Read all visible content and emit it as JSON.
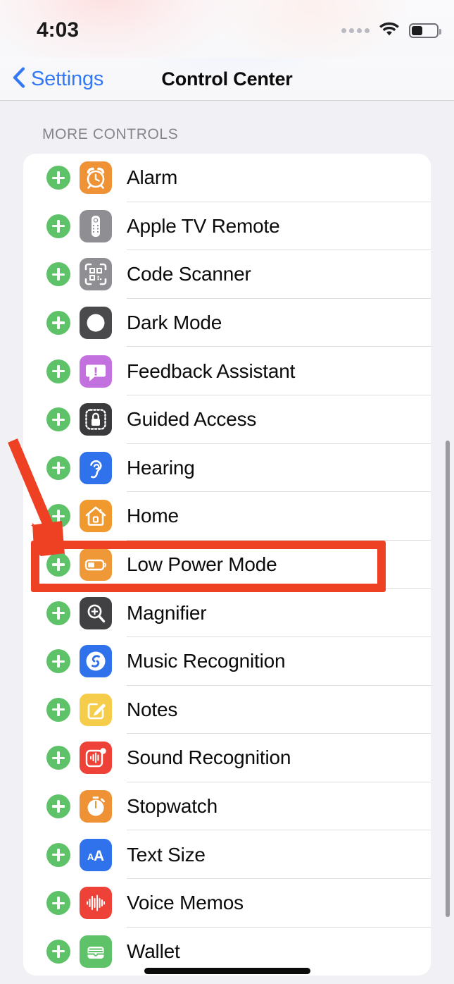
{
  "status_bar": {
    "time": "4:03",
    "cellular_icon": "cellular-dots-icon",
    "cellular_dots": 4,
    "wifi_icon": "wifi-icon",
    "battery_icon": "battery-icon",
    "battery_level_percent": 38
  },
  "nav": {
    "back_icon": "chevron-left-icon",
    "back_label": "Settings",
    "title": "Control Center"
  },
  "section": {
    "header": "MORE CONTROLS"
  },
  "colors": {
    "accent_blue": "#3478f6",
    "add_green": "#5ec269",
    "annotation_red": "#ee4023",
    "page_background": "#f1f1f5",
    "card_background": "#ffffff"
  },
  "annotation": {
    "highlight_target": "Hearing",
    "box_color": "#ee4023",
    "arrow_color": "#ee4023",
    "arrow_icon": "arrow-pointing-down-right-icon"
  },
  "rows": [
    {
      "label": "Alarm",
      "add_icon": "add-plus-icon",
      "icon": "alarm-clock-icon",
      "icon_bg": "#ef9235",
      "highlighted": false
    },
    {
      "label": "Apple TV Remote",
      "add_icon": "add-plus-icon",
      "icon": "tv-remote-icon",
      "icon_bg": "#8e8e93",
      "highlighted": false
    },
    {
      "label": "Code Scanner",
      "add_icon": "add-plus-icon",
      "icon": "qr-code-scanner-icon",
      "icon_bg": "#8e8e93",
      "highlighted": false
    },
    {
      "label": "Dark Mode",
      "add_icon": "add-plus-icon",
      "icon": "dark-mode-circle-icon",
      "icon_bg": "#4a4a4d",
      "highlighted": false
    },
    {
      "label": "Feedback Assistant",
      "add_icon": "add-plus-icon",
      "icon": "feedback-bubble-icon",
      "icon_bg": "#c471e0",
      "highlighted": false
    },
    {
      "label": "Guided Access",
      "add_icon": "add-plus-icon",
      "icon": "guided-access-lock-icon",
      "icon_bg": "#3a3a3c",
      "highlighted": false
    },
    {
      "label": "Hearing",
      "add_icon": "add-plus-icon",
      "icon": "hearing-ear-icon",
      "icon_bg": "#2f72eb",
      "highlighted": true
    },
    {
      "label": "Home",
      "add_icon": "add-plus-icon",
      "icon": "home-house-icon",
      "icon_bg": "#f0992f",
      "highlighted": false
    },
    {
      "label": "Low Power Mode",
      "add_icon": "add-plus-icon",
      "icon": "low-power-battery-icon",
      "icon_bg": "#ef9838",
      "highlighted": false
    },
    {
      "label": "Magnifier",
      "add_icon": "add-plus-icon",
      "icon": "magnifier-icon",
      "icon_bg": "#414143",
      "highlighted": false
    },
    {
      "label": "Music Recognition",
      "add_icon": "add-plus-icon",
      "icon": "shazam-icon",
      "icon_bg": "#2f72eb",
      "highlighted": false
    },
    {
      "label": "Notes",
      "add_icon": "add-plus-icon",
      "icon": "notes-pencil-icon",
      "icon_bg": "#f5cd4a",
      "highlighted": false
    },
    {
      "label": "Sound Recognition",
      "add_icon": "add-plus-icon",
      "icon": "sound-recognition-icon",
      "icon_bg": "#ee4137",
      "highlighted": false
    },
    {
      "label": "Stopwatch",
      "add_icon": "add-plus-icon",
      "icon": "stopwatch-icon",
      "icon_bg": "#ef9235",
      "highlighted": false
    },
    {
      "label": "Text Size",
      "add_icon": "add-plus-icon",
      "icon": "text-size-aa-icon",
      "icon_bg": "#2f72eb",
      "highlighted": false
    },
    {
      "label": "Voice Memos",
      "add_icon": "add-plus-icon",
      "icon": "voice-memos-waveform-icon",
      "icon_bg": "#ee4137",
      "highlighted": false
    },
    {
      "label": "Wallet",
      "add_icon": "add-plus-icon",
      "icon": "wallet-icon",
      "icon_bg": "#5ec269",
      "highlighted": false
    }
  ]
}
